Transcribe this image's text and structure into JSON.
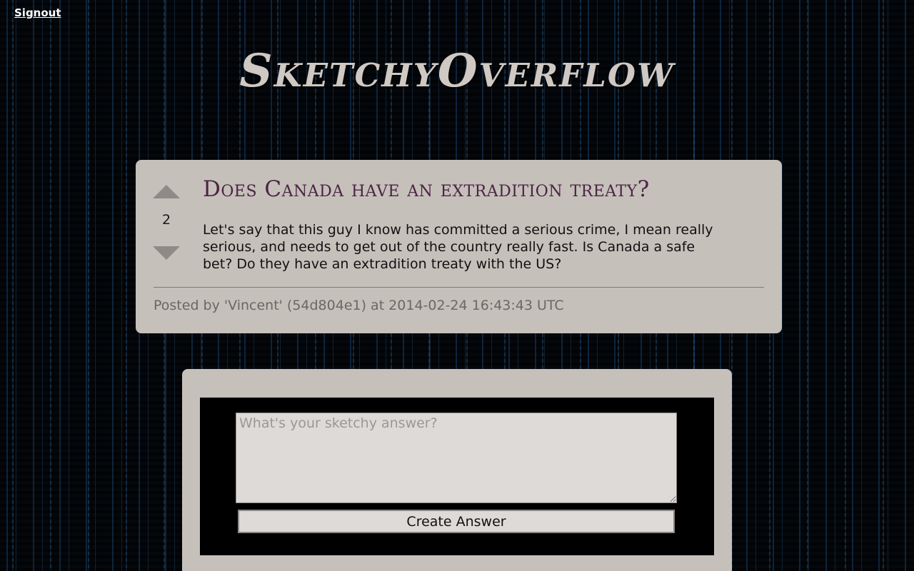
{
  "nav": {
    "signout_label": "Signout"
  },
  "site": {
    "title": "SketchyOverflow"
  },
  "question": {
    "title": "Does Canada have an extradition treaty?",
    "body": "Let's say that this guy I know has committed a serious crime, I mean really serious, and needs to get out of the country really fast. Is Canada a safe bet? Do they have an extradition treaty with the US?",
    "votes": "2",
    "posted_by": "Posted by 'Vincent' (54d804e1) at 2014-02-24 16:43:43 UTC",
    "upvote_icon": "triangle-up-icon",
    "downvote_icon": "triangle-down-icon"
  },
  "answer_form": {
    "placeholder": "What's your sketchy answer?",
    "value": "",
    "submit_label": "Create Answer"
  },
  "colors": {
    "card_background": "#c6c0bb",
    "title_color": "#4b2544",
    "site_title_color": "#cfc8c3",
    "page_background": "#04070c",
    "vote_arrow": "#8f8a86"
  }
}
